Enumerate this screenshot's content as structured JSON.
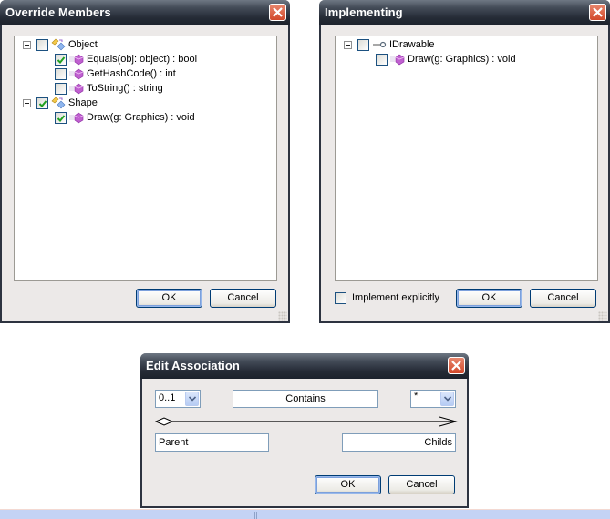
{
  "override_dialog": {
    "title": "Override Members",
    "tree": [
      {
        "label": "Object",
        "checked": false,
        "icon": "class-icon",
        "children": [
          {
            "label": "Equals(obj: object) : bool",
            "checked": true,
            "icon": "method-icon"
          },
          {
            "label": "GetHashCode() : int",
            "checked": false,
            "icon": "method-icon"
          },
          {
            "label": "ToString() : string",
            "checked": false,
            "icon": "method-icon"
          }
        ]
      },
      {
        "label": "Shape",
        "checked": true,
        "icon": "class-icon",
        "children": [
          {
            "label": "Draw(g: Graphics) : void",
            "checked": true,
            "icon": "method-icon"
          }
        ]
      }
    ],
    "ok_label": "OK",
    "cancel_label": "Cancel"
  },
  "implementing_dialog": {
    "title": "Implementing",
    "tree": [
      {
        "label": "IDrawable",
        "checked": false,
        "icon": "interface-icon",
        "children": [
          {
            "label": "Draw(g: Graphics) : void",
            "checked": false,
            "icon": "method-icon"
          }
        ]
      }
    ],
    "implement_explicitly_label": "Implement explicitly",
    "implement_explicitly_checked": false,
    "ok_label": "OK",
    "cancel_label": "Cancel"
  },
  "association_dialog": {
    "title": "Edit Association",
    "start_multiplicity": "0..1",
    "name": "Contains",
    "end_multiplicity": "*",
    "start_role": "Parent",
    "end_role": "Childs",
    "ok_label": "OK",
    "cancel_label": "Cancel"
  },
  "colors": {
    "titlebar": "#252b36",
    "dialog_bg": "#ece9e8",
    "close_button": "#d2482a",
    "checkmark": "#21a121",
    "taskbar": "#c4d3f5"
  }
}
